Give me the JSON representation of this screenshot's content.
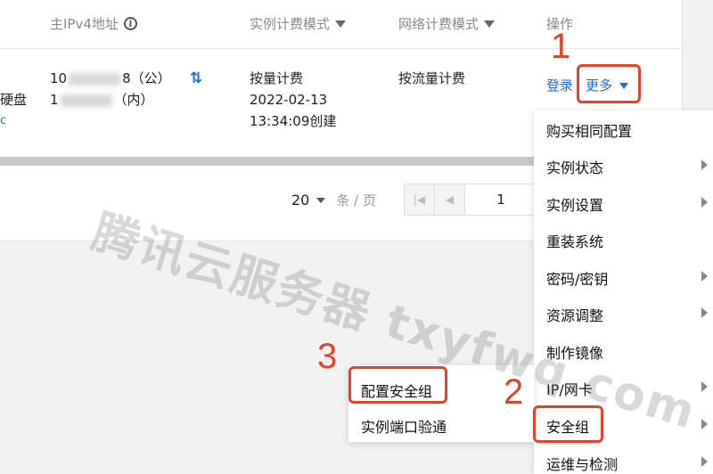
{
  "table": {
    "headers": {
      "ipv4": "主IPv4地址",
      "billing_mode": "实例计费模式",
      "network_billing": "网络计费模式",
      "actions": "操作"
    },
    "row": {
      "disk_fragment": "硬盘",
      "ip_public_prefix": "10",
      "ip_public_suffix": "8（公）",
      "ip_private_prefix": "1",
      "ip_private_suffix": "（内）",
      "billing_mode": "按量计费",
      "created_date": "2022-02-13",
      "created_time": "13:34:09创建",
      "network_billing": "按流量计费",
      "login_link": "登录",
      "more_button": "更多"
    }
  },
  "pagination": {
    "page_size": "20",
    "unit": "条 / 页",
    "current_page": "1"
  },
  "more_menu": {
    "items": [
      {
        "label": "购买相同配置",
        "has_submenu": false
      },
      {
        "label": "实例状态",
        "has_submenu": true
      },
      {
        "label": "实例设置",
        "has_submenu": true
      },
      {
        "label": "重装系统",
        "has_submenu": false
      },
      {
        "label": "密码/密钥",
        "has_submenu": true
      },
      {
        "label": "资源调整",
        "has_submenu": true
      },
      {
        "label": "制作镜像",
        "has_submenu": false
      },
      {
        "label": "IP/网卡",
        "has_submenu": true
      },
      {
        "label": "安全组",
        "has_submenu": true
      },
      {
        "label": "运维与检测",
        "has_submenu": true
      }
    ]
  },
  "security_group_submenu": {
    "items": [
      "配置安全组",
      "实例端口验通"
    ]
  },
  "annotations": {
    "step1": "1",
    "step2": "2",
    "step3": "3",
    "highlight_color": "#e2432a"
  },
  "watermark": "腾讯云服务器 txyfwq.com",
  "colors": {
    "link_blue": "#1a6fd9"
  }
}
